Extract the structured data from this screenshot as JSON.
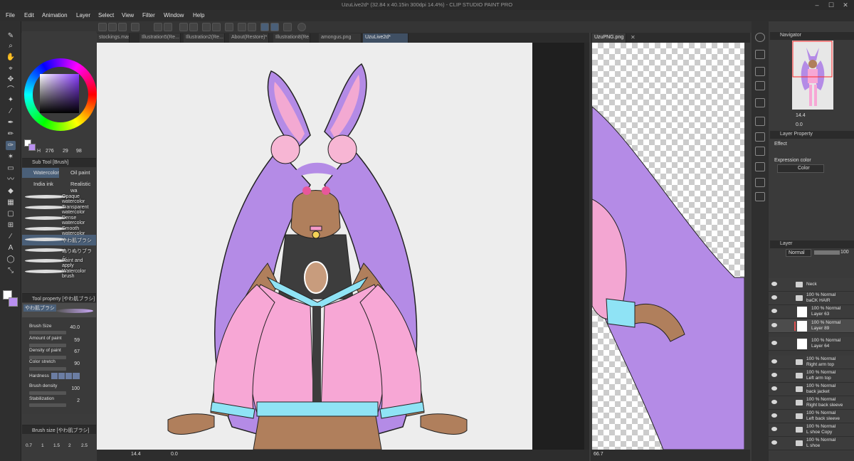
{
  "title": "UzuLive2d* (32.84 x 40.15in 300dpi 14.4%) - CLIP STUDIO PAINT PRO",
  "menu": [
    "File",
    "Edit",
    "Animation",
    "Layer",
    "Select",
    "View",
    "Filter",
    "Window",
    "Help"
  ],
  "doc_tabs": [
    "stockings.mask",
    "Illustration5(Re...",
    "Illustration2(Re...",
    "About(Restore)*",
    "Illustration8(Re...",
    "amongus.png",
    "UzuLive2d*"
  ],
  "second_tab": "UzuPNG.png",
  "color": {
    "main": "#ffffff",
    "sub": "#b98ff0",
    "hue": "#8a3cff",
    "readout": {
      "h": "276",
      "s": "29",
      "v": "98"
    }
  },
  "subtool": {
    "title": "Sub Tool [Brush]",
    "tabs": [
      "Watercolor",
      "Oil paint",
      "India ink",
      "Realistic wa"
    ],
    "brushes": [
      "Opaque watercolor",
      "Transparent watercolor",
      "Dense watercolor",
      "Smooth watercolor",
      "やわ肌ブラシ",
      "ぬりぬりブラシ",
      "Paint and apply",
      "Watercolor brush"
    ]
  },
  "toolprop": {
    "title": "Tool property [やわ肌ブラシ]",
    "brush_name": "やわ肌ブラシ",
    "rows": [
      {
        "label": "Brush Size",
        "value": "40.0"
      },
      {
        "label": "Amount of paint",
        "value": "59"
      },
      {
        "label": "Density of paint",
        "value": "67"
      },
      {
        "label": "Color stretch",
        "value": "90"
      },
      {
        "label": "Hardness",
        "value": ""
      },
      {
        "label": "Brush density",
        "value": "100"
      },
      {
        "label": "Stabilization",
        "value": "2"
      }
    ]
  },
  "brushsize": {
    "title": "Brush size [やわ肌ブラシ]",
    "steps": [
      "0.7",
      "1",
      "1.5",
      "2",
      "2.5"
    ]
  },
  "status": {
    "zoom_main": "14.4",
    "rot_main": "0.0",
    "zoom_second": "66.7"
  },
  "navigator": {
    "title": "Navigator",
    "zoom": "14.4",
    "angle": "0.0"
  },
  "layer_property": {
    "title": "Layer Property",
    "effect": "Effect",
    "expression_label": "Expression color",
    "expression_value": "Color"
  },
  "layer_panel": {
    "title": "Layer",
    "blend": "Normal",
    "opacity": "100",
    "layers": [
      {
        "l1": "Neck",
        "l2": "",
        "type": "folder"
      },
      {
        "l1": "100 % Normal",
        "l2": "baCK HAIR",
        "type": "folder"
      },
      {
        "l1": "100 % Normal",
        "l2": "Layer 63",
        "type": "raster"
      },
      {
        "l1": "100 % Normal",
        "l2": "Layer 89",
        "type": "raster"
      },
      {
        "l1": "100 % Normal",
        "l2": "Layer 64",
        "type": "raster"
      },
      {
        "l1": "100 % Normal",
        "l2": "Right arm top",
        "type": "folder"
      },
      {
        "l1": "100 % Normal",
        "l2": "Left arm top",
        "type": "folder"
      },
      {
        "l1": "100 % Normal",
        "l2": "back jacket",
        "type": "folder"
      },
      {
        "l1": "100 % Normal",
        "l2": "Right back sleeve",
        "type": "folder"
      },
      {
        "l1": "100 % Normal",
        "l2": "Left back sleeve",
        "type": "folder"
      },
      {
        "l1": "100 % Normal",
        "l2": "L shoe Copy",
        "type": "folder"
      },
      {
        "l1": "100 % Normal",
        "l2": "L shoe",
        "type": "folder"
      }
    ]
  }
}
